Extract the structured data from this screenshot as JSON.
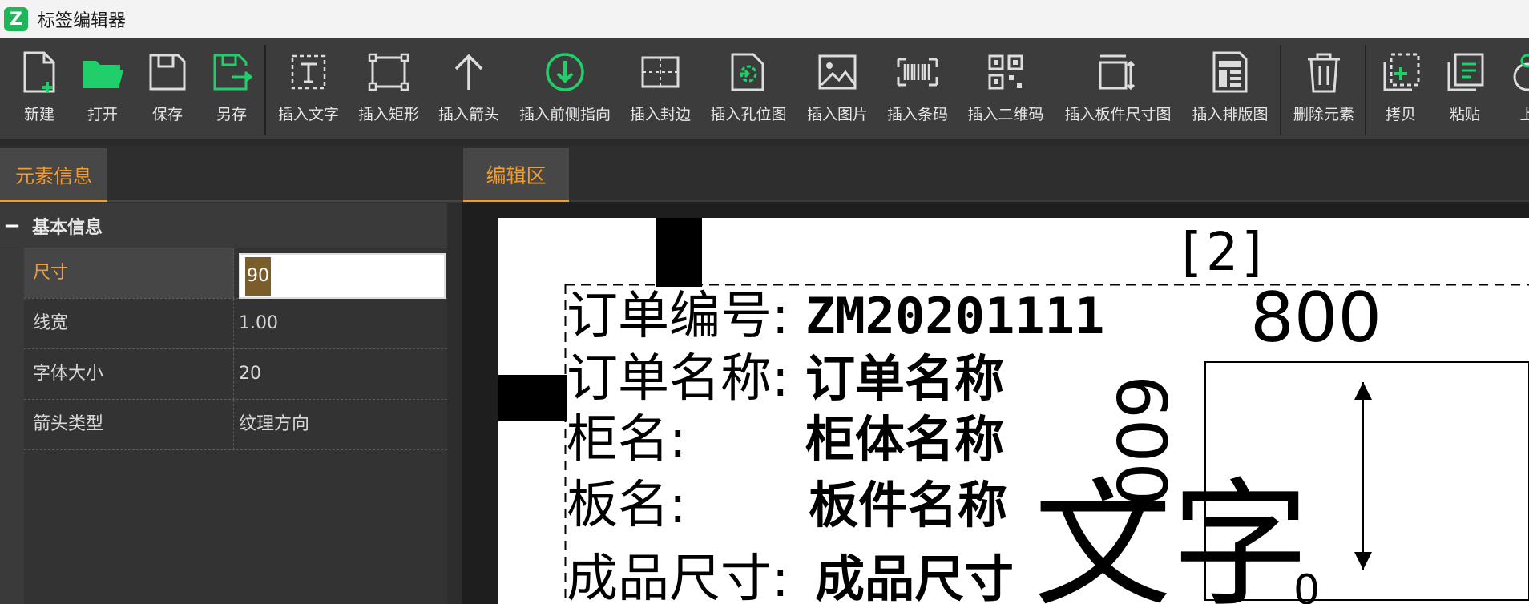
{
  "window": {
    "logo_letter": "Z",
    "title": "标签编辑器"
  },
  "toolbar": {
    "buttons": [
      {
        "label": "新建",
        "icon": "new-file-icon"
      },
      {
        "label": "打开",
        "icon": "open-folder-icon"
      },
      {
        "label": "保存",
        "icon": "save-icon"
      },
      {
        "label": "另存",
        "icon": "save-as-icon"
      },
      {
        "label": "插入文字",
        "icon": "insert-text-icon"
      },
      {
        "label": "插入矩形",
        "icon": "insert-rect-icon"
      },
      {
        "label": "插入箭头",
        "icon": "insert-arrow-icon"
      },
      {
        "label": "插入前侧指向",
        "icon": "insert-front-pointer-icon"
      },
      {
        "label": "插入封边",
        "icon": "insert-edge-band-icon"
      },
      {
        "label": "插入孔位图",
        "icon": "insert-hole-map-icon"
      },
      {
        "label": "插入图片",
        "icon": "insert-image-icon"
      },
      {
        "label": "插入条码",
        "icon": "insert-barcode-icon"
      },
      {
        "label": "插入二维码",
        "icon": "insert-qrcode-icon"
      },
      {
        "label": "插入板件尺寸图",
        "icon": "insert-panel-size-icon"
      },
      {
        "label": "插入排版图",
        "icon": "insert-layout-icon"
      },
      {
        "label": "删除元素",
        "icon": "trash-icon"
      },
      {
        "label": "拷贝",
        "icon": "copy-icon"
      },
      {
        "label": "粘贴",
        "icon": "paste-icon"
      },
      {
        "label": "上",
        "icon": "up-icon"
      }
    ],
    "colors": {
      "accent_green": "#1fd06a",
      "icon_gray": "#dddddd"
    }
  },
  "left_panel": {
    "tab": "元素信息",
    "group": {
      "collapse_symbol": "−",
      "title": "基本信息"
    },
    "properties": [
      {
        "key": "尺寸",
        "value": "90"
      },
      {
        "key": "线宽",
        "value": "1.00"
      },
      {
        "key": "字体大小",
        "value": "20"
      },
      {
        "key": "箭头类型",
        "value": "纹理方向"
      }
    ]
  },
  "editor": {
    "tab": "编辑区",
    "label": {
      "page_marker": "[2]",
      "rows": [
        {
          "key": "订单编号:",
          "value": "ZM20201111"
        },
        {
          "key": "订单名称:",
          "value": "订单名称"
        },
        {
          "key": "柜名:",
          "value": "柜体名称"
        },
        {
          "key": "板名:",
          "value": "板件名称"
        },
        {
          "key": "成品尺寸:",
          "value": "成品尺寸"
        }
      ],
      "width_dim": "800",
      "height_dim": "600",
      "big_text": "文字",
      "corner_dim": "0"
    }
  },
  "theme": {
    "accent_orange": "#f39c2f"
  }
}
